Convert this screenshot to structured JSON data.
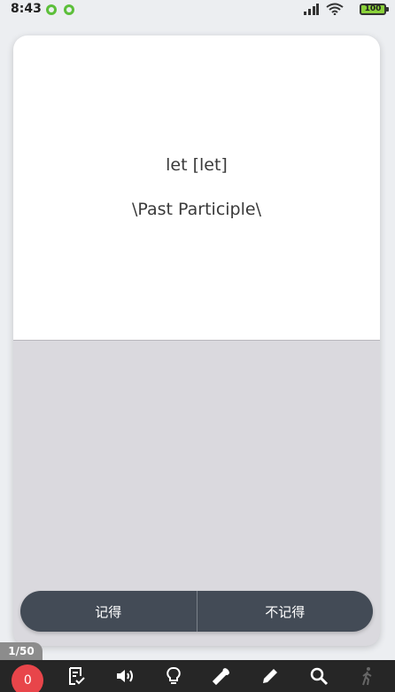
{
  "status_bar": {
    "time": "8:43",
    "battery": "100",
    "icons": [
      "notification-icon",
      "notification-icon",
      "hd-signal-icon",
      "wifi-icon",
      "battery-icon"
    ]
  },
  "card": {
    "word": "let [let]",
    "form": "\\Past Participle\\"
  },
  "buttons": {
    "remember": "记得",
    "forget": "不记得"
  },
  "progress": "1/50",
  "toolbar": {
    "count": "0",
    "icons": [
      "checklist-icon",
      "speaker-icon",
      "lightbulb-icon",
      "wrench-icon",
      "pencil-icon",
      "search-icon",
      "walk-icon"
    ]
  },
  "colors": {
    "button_bg": "#434b56",
    "card_back": "#dad9de",
    "badge": "#e8454a",
    "toolbar": "#262626"
  }
}
